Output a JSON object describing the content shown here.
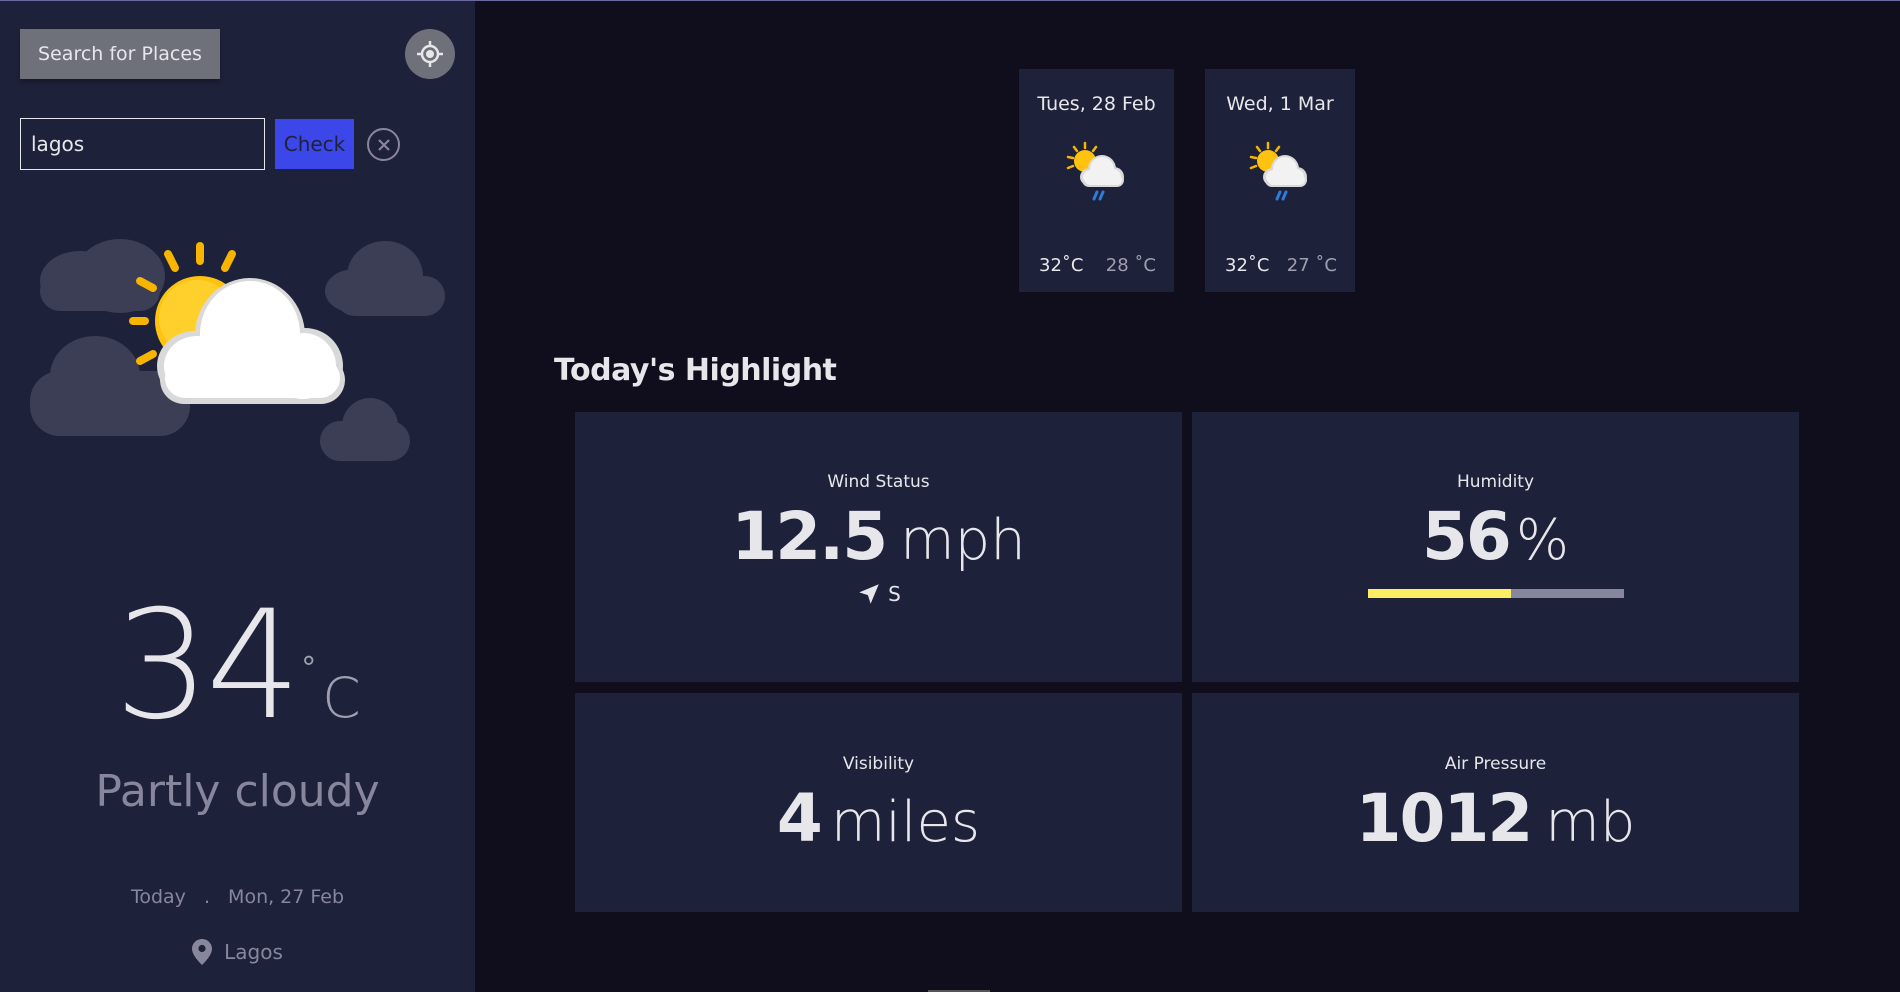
{
  "sidebar": {
    "search_button_label": "Search for Places",
    "search_input_value": "lagos",
    "check_button_label": "Check",
    "temperature": "34",
    "degree_symbol": "°",
    "temperature_unit": "C",
    "condition": "Partly cloudy",
    "date_today": "Today",
    "date_separator": ".",
    "date_value": "Mon, 27 Feb",
    "location": "Lagos",
    "icons": {
      "locate": "crosshair-icon",
      "clear": "close-circle-icon",
      "location": "map-pin-icon",
      "weather": "partly-cloudy-illustration"
    }
  },
  "forecast": [
    {
      "date": "Tues, 28 Feb",
      "max": "32˚C",
      "min": "28 ˚C",
      "icon": "sun-cloud-rain-icon"
    },
    {
      "date": "Wed, 1 Mar",
      "max": "32˚C",
      "min": "27 ˚C",
      "icon": "sun-cloud-rain-icon"
    }
  ],
  "highlights": {
    "title": "Today's Highlight",
    "wind": {
      "label": "Wind Status",
      "value": "12.5",
      "unit": "mph",
      "direction": "S",
      "icon": "navigation-arrow-icon"
    },
    "humidity": {
      "label": "Humidity",
      "value": "56",
      "unit": "%",
      "percent": 56
    },
    "visibility": {
      "label": "Visibility",
      "value": "4",
      "unit": "miles"
    },
    "pressure": {
      "label": "Air Pressure",
      "value": "1012",
      "unit": "mb"
    }
  },
  "colors": {
    "background": "#100e1d",
    "panel": "#1e213a",
    "accent_blue": "#3c47e9",
    "humidity_fill": "#ffec65",
    "muted_text": "#88869d"
  }
}
